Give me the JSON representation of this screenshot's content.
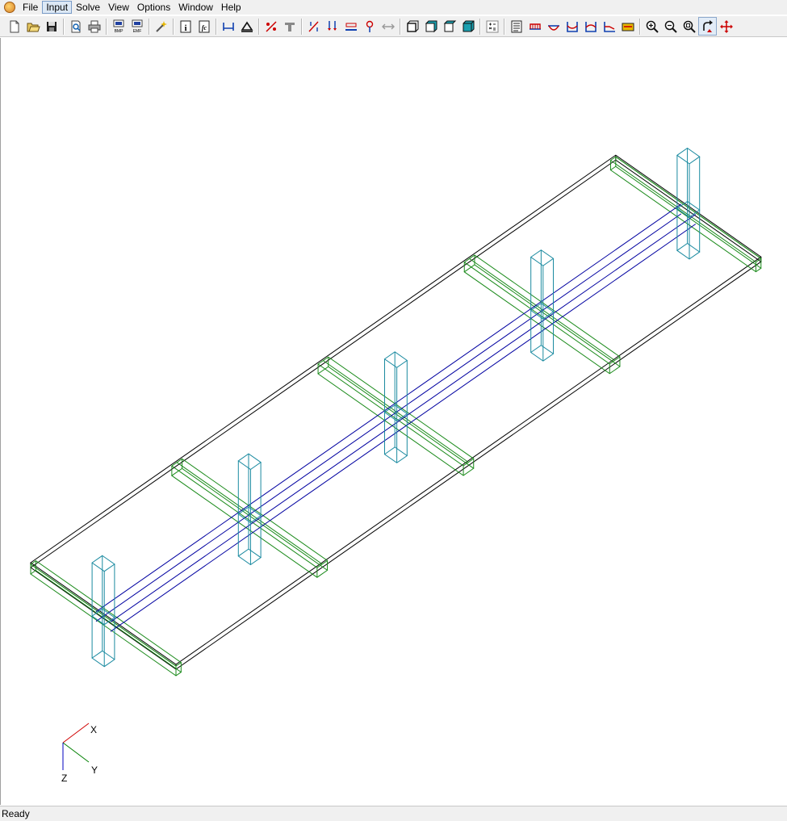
{
  "menu": {
    "items": [
      "File",
      "Input",
      "Solve",
      "View",
      "Options",
      "Window",
      "Help"
    ],
    "active_index": 1
  },
  "toolbar": {
    "buttons": [
      "new-file-icon",
      "open-folder-icon",
      "save-icon",
      "print-preview-icon",
      "print-icon",
      "export-bmp-icon",
      "export-emf-icon",
      "wizard-icon",
      "info-icon",
      "fc-icon",
      "dimension-icon",
      "support-icon",
      "member-release-icon",
      "section-icon",
      "percent-load-icon",
      "load-arrows-icon",
      "distributed-load-icon",
      "node-load-icon",
      "moving-load-icon",
      "view-front-icon",
      "view-side-icon",
      "view-top-icon",
      "view-3d-icon",
      "math-icon",
      "report-icon",
      "moment-diagram-icon",
      "shear-diagram-icon",
      "deflection-icon",
      "axial-icon",
      "displacement-icon",
      "stress-icon",
      "zoom-in-icon",
      "zoom-out-icon",
      "zoom-extents-icon",
      "rotate-icon",
      "pan-icon"
    ],
    "labels": {
      "bmp": "BMP",
      "emf": "EMF",
      "info": "i",
      "fc": "fc"
    },
    "pressed": "rotate-icon"
  },
  "axis": {
    "x": "X",
    "y": "Y",
    "z": "Z"
  },
  "status": {
    "text": "Ready"
  },
  "colors": {
    "slab": "#000000",
    "beam": "#1a8a1a",
    "column": "#1a8aa0",
    "girder": "#0000a0",
    "axis_x": "#d00000",
    "axis_y": "#008000",
    "axis_z": "#0000c0"
  }
}
